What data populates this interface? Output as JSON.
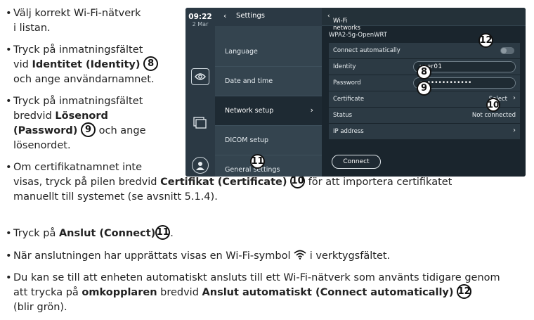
{
  "document": {
    "bullets": [
      {
        "line1": "Välj korrekt Wi-Fi-nätverk",
        "line2": "i listan."
      },
      {
        "line1": "Tryck på inmatningsfältet",
        "line2_pre": "vid ",
        "line2_bold": "Identitet (Identity)",
        "line2_num": "8",
        "line3": "och ange användarnamnet."
      },
      {
        "line1": "Tryck på inmatningsfältet",
        "line2_pre": "bredvid ",
        "line2_bold": "Lösenord",
        "line3_bold": "(Password)",
        "line3_num": "9",
        "line3_post": " och ange",
        "line4": "lösenordet."
      },
      {
        "line1": "Om certifikatnamnet inte",
        "line2_pre": "visas, tryck på pilen bredvid ",
        "line2_bold": "Certifikat (Certificate)",
        "line2_num": "10",
        "line2_post": " för att importera certifikatet",
        "line3": "manuellt till systemet (se avsnitt 5.1.4)."
      },
      {
        "pre": "Tryck på ",
        "bold": "Anslut (Connect)",
        "num": "11",
        "post": "."
      },
      {
        "pre": "När anslutningen har upprättats visas en Wi-Fi-symbol ",
        "post": " i verktygsfältet."
      },
      {
        "line1": "Du kan se till att enheten automatiskt ansluts till ett Wi-Fi-nätverk som använts tidigare genom",
        "line2_pre": "att trycka på ",
        "line2_bold": "omkopplaren",
        "line2_mid": " bredvid ",
        "line2_bold2": "Anslut automatiskt (Connect automatically)",
        "line2_num": "12",
        "line3": "(blir grön)."
      }
    ]
  },
  "device": {
    "time": "09:22",
    "date": "2 Mar",
    "menu_title": "Settings",
    "menu_items": [
      "Language",
      "Date and time",
      "Network setup",
      "DICOM setup",
      "General settings"
    ],
    "panel_title": "Wi-Fi networks",
    "ssid": "WPA2-5g-OpenWRT",
    "rows": {
      "connect_auto": "Connect automatically",
      "identity": "Identity",
      "identity_value": "user01",
      "password": "Password",
      "password_value": "••••••••••••••",
      "certificate": "Certificate",
      "certificate_value": "Select",
      "status": "Status",
      "status_value": "Not connected",
      "ip": "IP address"
    },
    "connect_button": "Connect",
    "callouts": [
      "8",
      "9",
      "10",
      "11",
      "12"
    ]
  }
}
